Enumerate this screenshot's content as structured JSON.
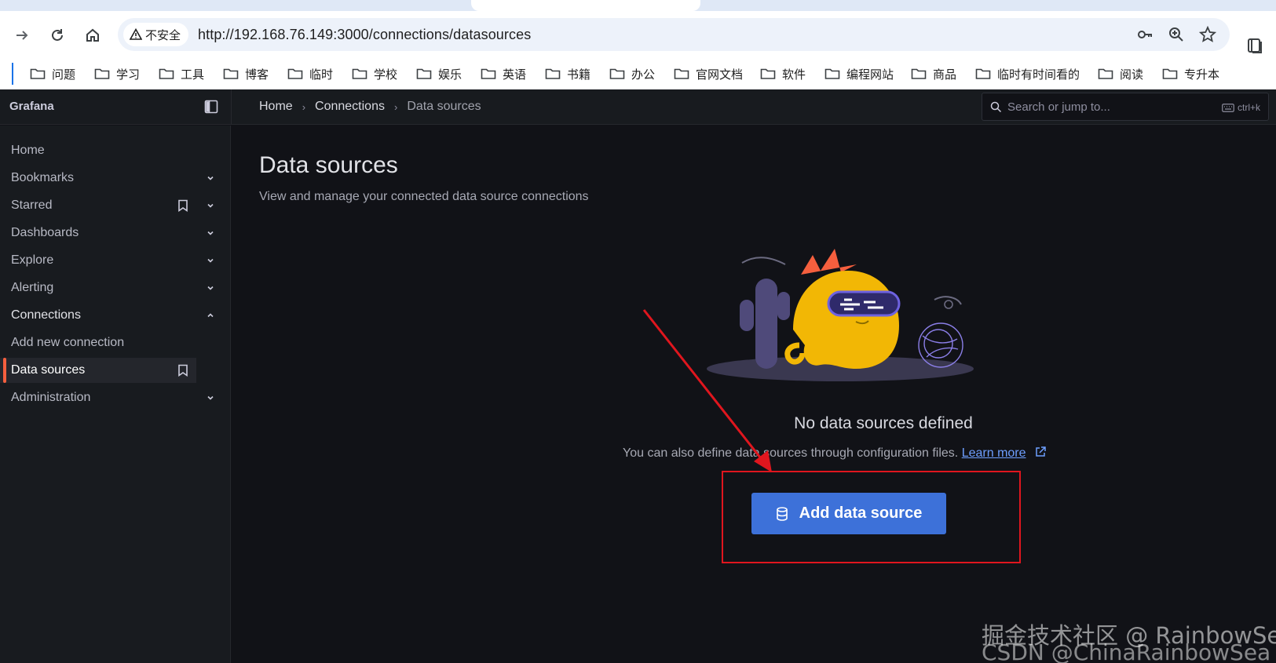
{
  "browser": {
    "security_label": "不安全",
    "url": "http://192.168.76.149:3000/connections/datasources",
    "bookmarks": [
      "问题",
      "学习",
      "工具",
      "博客",
      "临时",
      "学校",
      "娱乐",
      "英语",
      "书籍",
      "办公",
      "官网文档",
      "软件",
      "编程网站",
      "商品",
      "临时有时间看的",
      "阅读",
      "专升本"
    ]
  },
  "grafana": {
    "brand": "Grafana",
    "breadcrumb": [
      "Home",
      "Connections",
      "Data sources"
    ],
    "search_placeholder": "Search or jump to...",
    "search_shortcut": "ctrl+k",
    "nav": [
      {
        "label": "Home"
      },
      {
        "label": "Bookmarks"
      },
      {
        "label": "Starred"
      },
      {
        "label": "Dashboards"
      },
      {
        "label": "Explore"
      },
      {
        "label": "Alerting"
      },
      {
        "label": "Connections"
      },
      {
        "label": "Add new connection"
      },
      {
        "label": "Data sources"
      },
      {
        "label": "Administration"
      }
    ],
    "page_title": "Data sources",
    "page_subtitle": "View and manage your connected data source connections",
    "empty_title": "No data sources defined",
    "empty_text": "You can also define data sources through configuration files.",
    "learn_more": "Learn more",
    "add_button": "Add data source"
  },
  "watermark": {
    "line1": "掘金技术社区 @ RainbowSea",
    "line2": "CSDN @ChinaRainbowSea"
  },
  "colors": {
    "accent": "#3d71d9",
    "active_indicator": "#f55f3e",
    "annotation_red": "#e0161e"
  }
}
